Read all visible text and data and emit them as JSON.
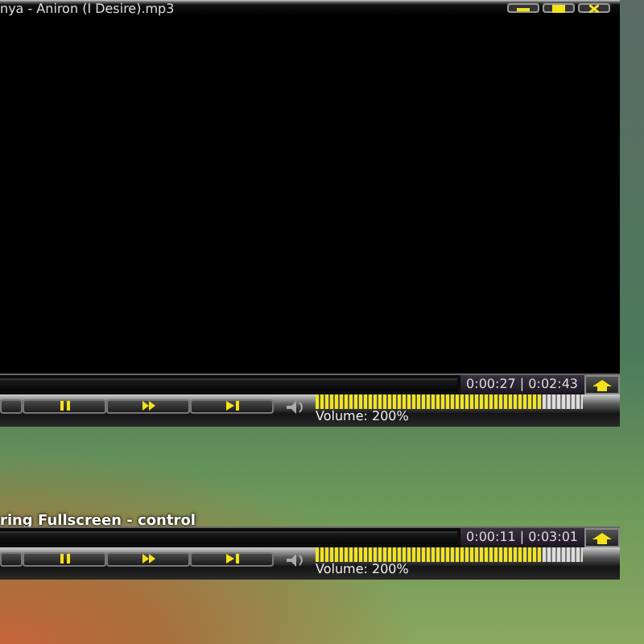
{
  "window": {
    "title": "nya - Aniron (I Desire).mp3"
  },
  "main_controls": {
    "time": "0:00:27 | 0:02:43",
    "volume_label": "Volume: 200%",
    "volume": {
      "level": 0.85
    }
  },
  "desktop_caption": "ring Fullscreen - control",
  "fullscreen_controls": {
    "time": "0:00:11 | 0:03:01",
    "volume_label": "Volume: 200%",
    "volume": {
      "level": 0.85
    }
  }
}
